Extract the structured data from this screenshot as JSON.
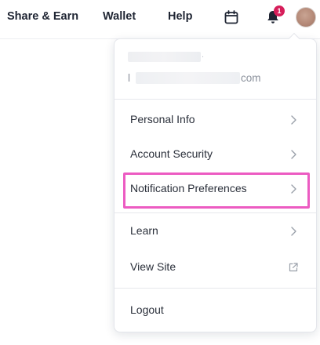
{
  "topbar": {
    "nav": [
      {
        "label": "Share & Earn"
      },
      {
        "label": "Wallet"
      },
      {
        "label": "Help"
      }
    ],
    "notification_count": "1",
    "icons": {
      "calendar": "calendar-icon",
      "bell": "bell-icon",
      "avatar": "avatar"
    }
  },
  "menu": {
    "user": {
      "email_prefix": "l",
      "email_suffix": "com"
    },
    "items": [
      {
        "label": "Personal Info",
        "icon": "chevron-right-icon"
      },
      {
        "label": "Account Security",
        "icon": "chevron-right-icon"
      },
      {
        "label": "Notification Preferences",
        "icon": "chevron-right-icon",
        "highlighted": true
      },
      {
        "label": "Learn",
        "icon": "chevron-right-icon"
      },
      {
        "label": "View Site",
        "icon": "external-link-icon"
      },
      {
        "label": "Logout"
      }
    ]
  },
  "colors": {
    "highlight": "#ec5bc2",
    "badge": "#d61e5a",
    "text": "#1f2533",
    "muted": "#8a909b"
  }
}
